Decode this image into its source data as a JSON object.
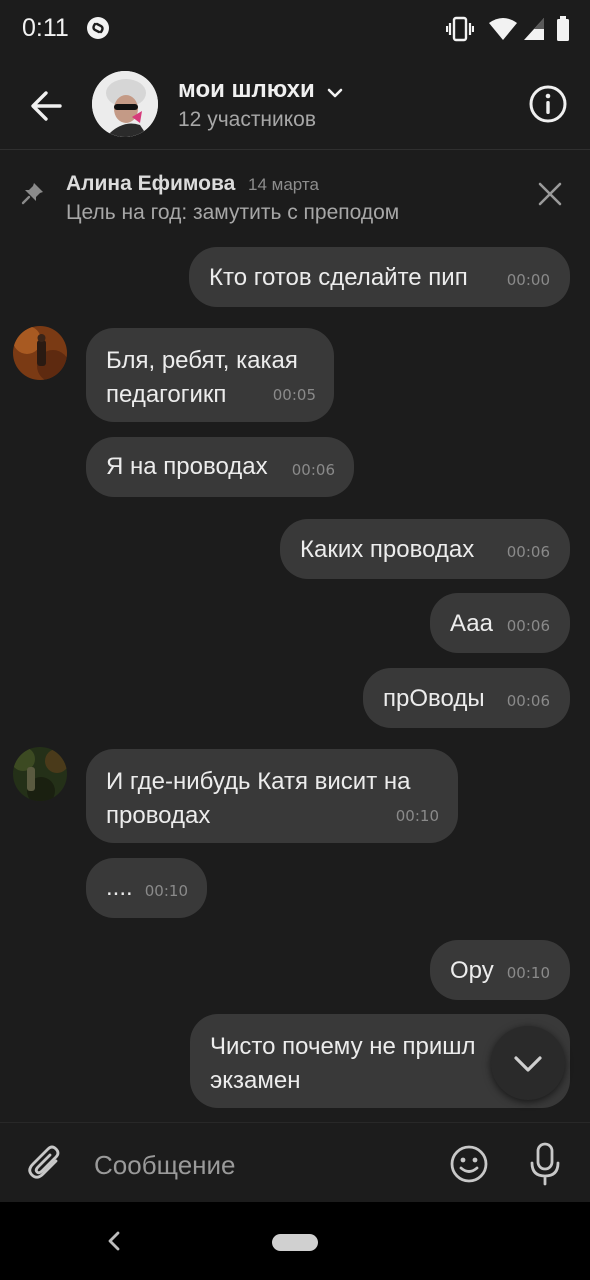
{
  "status_bar": {
    "time": "0:11"
  },
  "header": {
    "title": "мои шлюхи",
    "subtitle": "12 участников"
  },
  "pinned": {
    "author": "Алина Ефимова",
    "date": "14 марта",
    "text": "Цель на год: замутить с преподом"
  },
  "messages": [
    {
      "side": "out",
      "text": "Кто готов сделайте пип",
      "time": "00:00"
    },
    {
      "side": "in",
      "lines": [
        "Бля, ребят, какая",
        "педагогикп"
      ],
      "time": "00:05"
    },
    {
      "side": "in",
      "text": "Я на проводах",
      "time": "00:06"
    },
    {
      "side": "out",
      "text": "Каких проводах",
      "time": "00:06"
    },
    {
      "side": "out",
      "text": "Ааа",
      "time": "00:06"
    },
    {
      "side": "out",
      "text": "прОводы",
      "time": "00:06"
    },
    {
      "side": "in",
      "lines": [
        "И где-нибудь Катя висит на",
        "проводах"
      ],
      "time": "00:10"
    },
    {
      "side": "in",
      "text": "....",
      "time": "00:10"
    },
    {
      "side": "out",
      "text": "Ору",
      "time": "00:10"
    },
    {
      "side": "out",
      "lines": [
        "Чисто почему не пришл",
        "экзамен"
      ],
      "time": ""
    }
  ],
  "composer": {
    "placeholder": "Сообщение"
  },
  "icons": {
    "back": "arrow-left-icon",
    "info": "info-circle-icon",
    "pin": "pin-icon",
    "close": "close-icon",
    "attach": "paperclip-icon",
    "emoji": "smiley-icon",
    "mic": "microphone-icon",
    "scroll_down": "chevron-down-icon"
  },
  "colors": {
    "background": "#1c1c1c",
    "bubble": "#393939",
    "text": "#ececec",
    "secondary_text": "#a7a7a7"
  }
}
